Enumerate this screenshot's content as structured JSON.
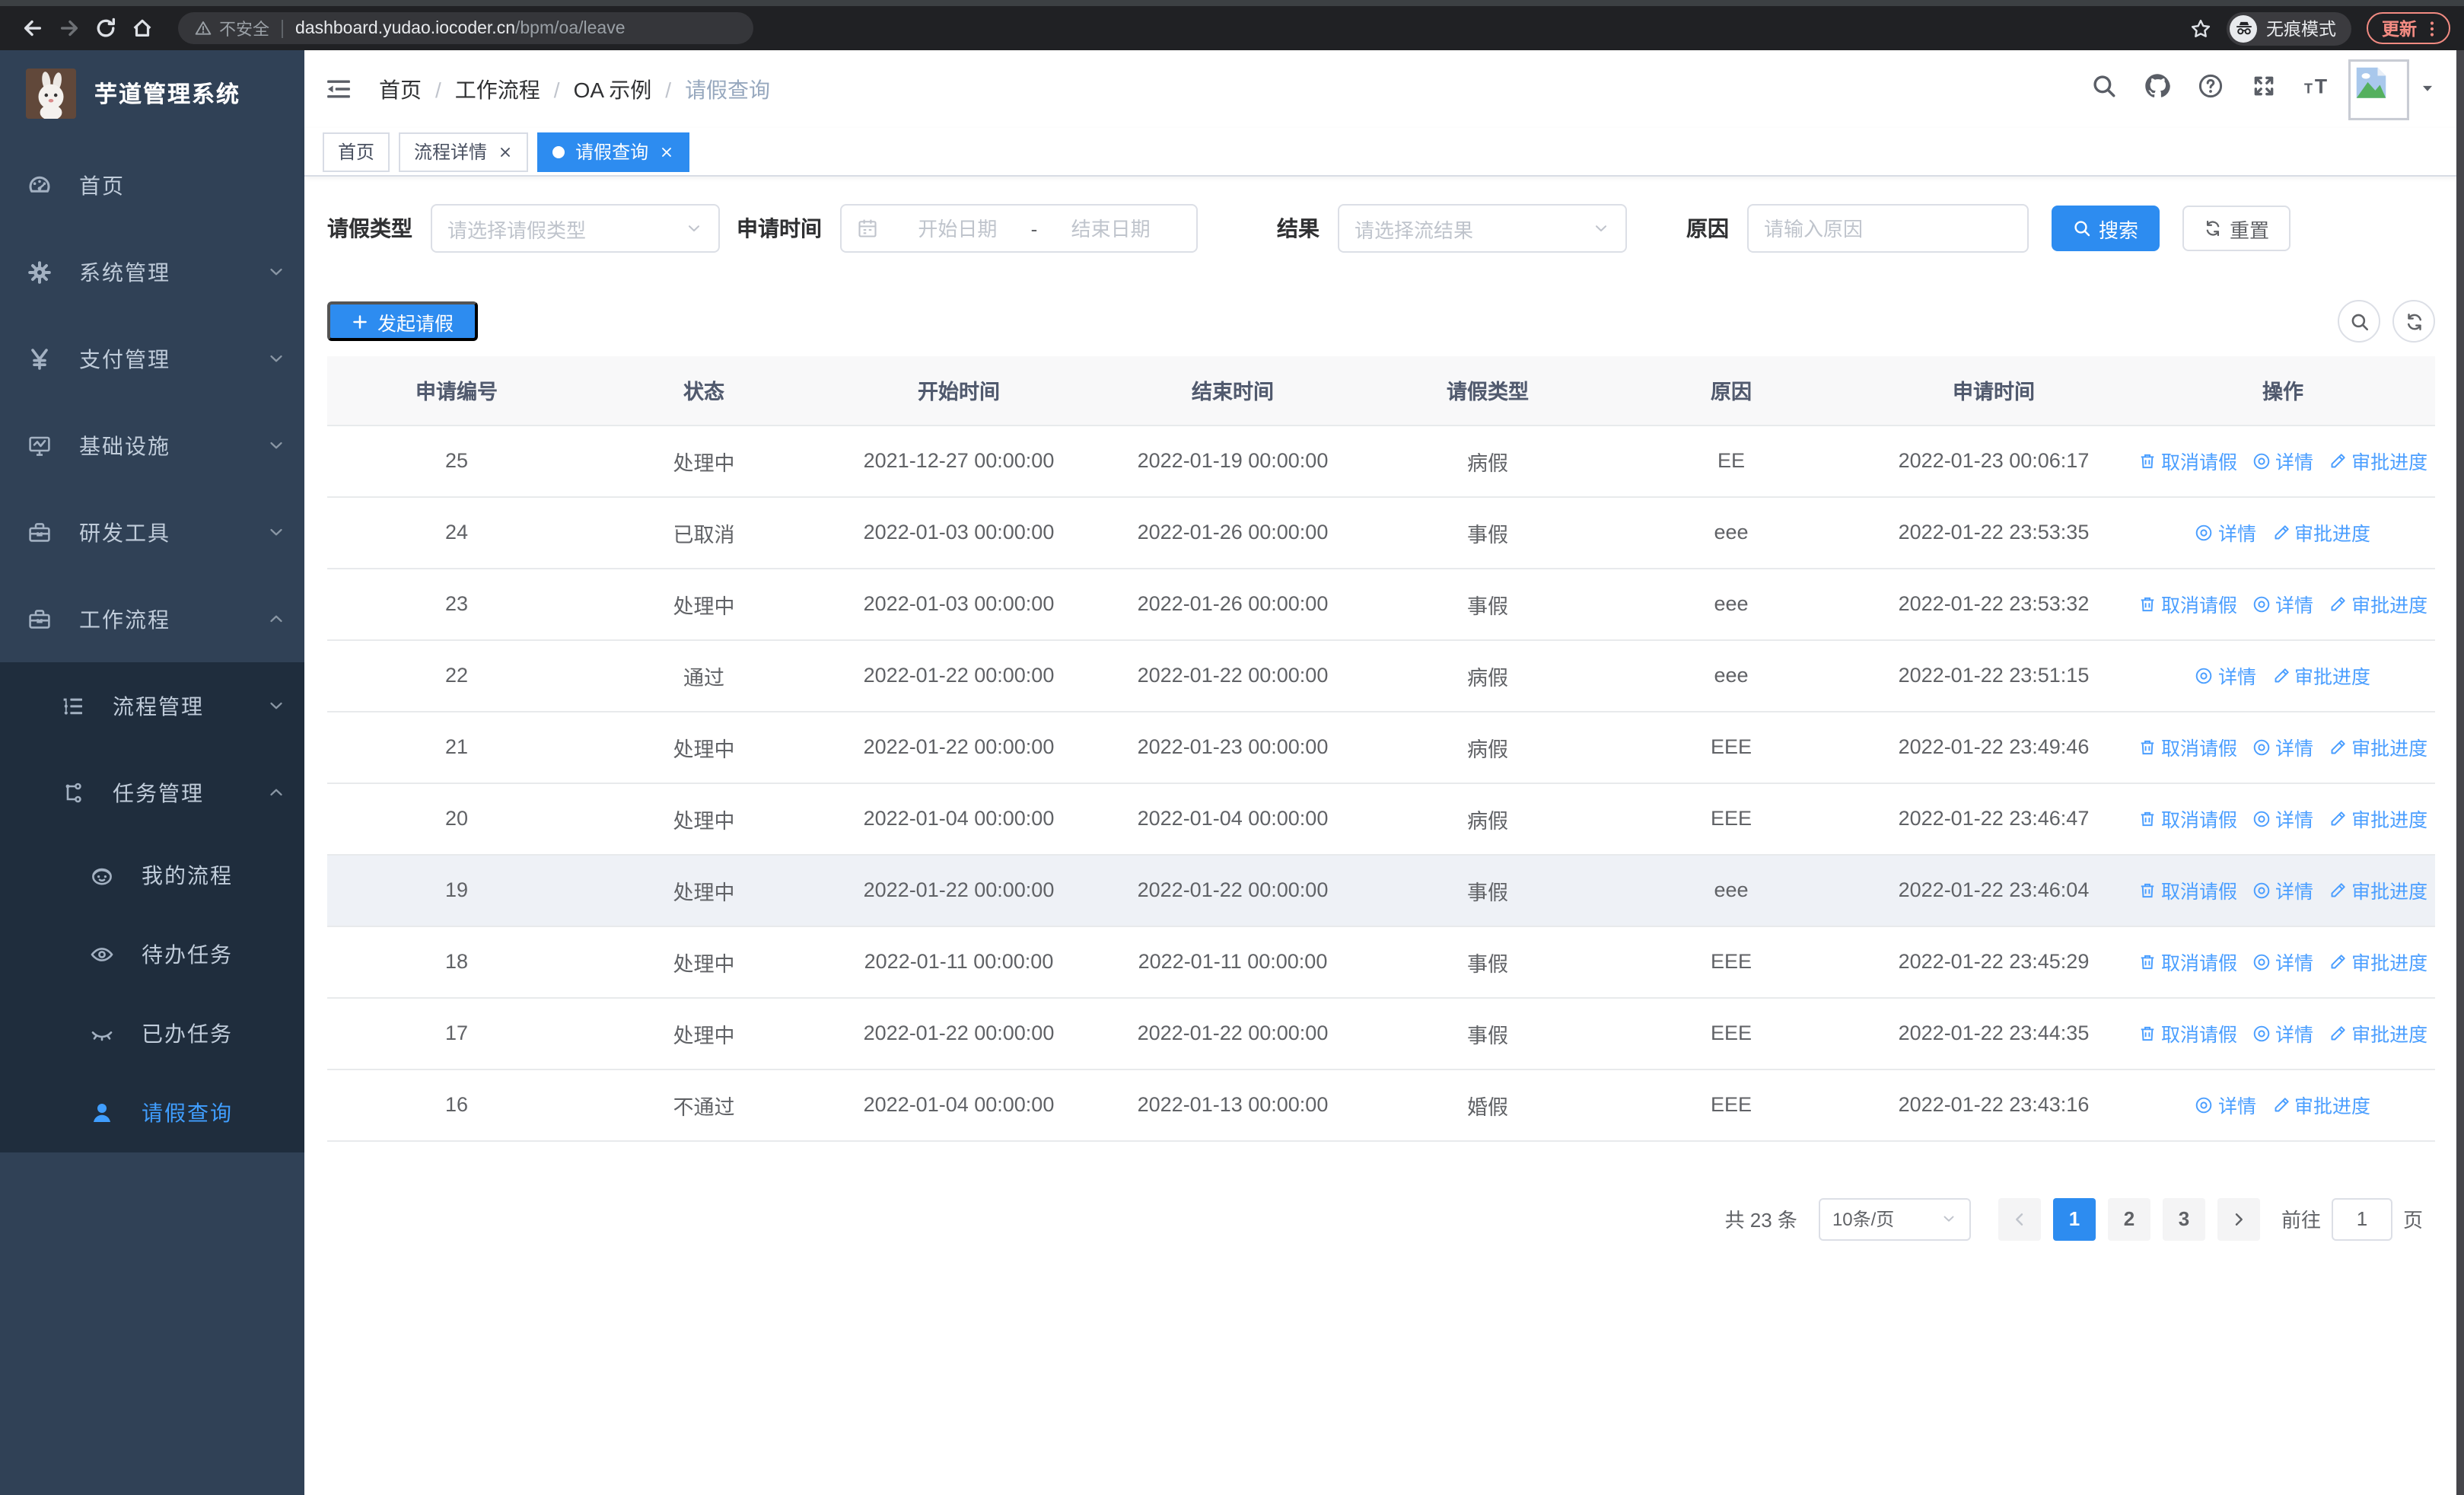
{
  "colors": {
    "primary_fill": "#2d8cf0",
    "primary_link": "#4a9eff",
    "sidebar_bg": "#304156",
    "submenu_bg": "#1f2d3d",
    "update_accent": "#f28b82"
  },
  "browser": {
    "security_label": "不安全",
    "url_host": "dashboard.yudao.iocoder.cn",
    "url_path": "/bpm/oa/leave",
    "incognito_label": "无痕模式",
    "update_label": "更新"
  },
  "sidebar": {
    "app_title": "芋道管理系统",
    "menu": [
      {
        "key": "home",
        "label": "首页",
        "icon": "dashboard-icon",
        "chevron": null,
        "level": 0,
        "dark": false,
        "active": false
      },
      {
        "key": "system",
        "label": "系统管理",
        "icon": "gear-icon",
        "chevron": "down",
        "level": 0,
        "dark": false,
        "active": false
      },
      {
        "key": "payment",
        "label": "支付管理",
        "icon": "yen-icon",
        "chevron": "down",
        "level": 0,
        "dark": false,
        "active": false
      },
      {
        "key": "infra",
        "label": "基础设施",
        "icon": "monitor-icon",
        "chevron": "down",
        "level": 0,
        "dark": false,
        "active": false
      },
      {
        "key": "dev-tools",
        "label": "研发工具",
        "icon": "toolbox-icon",
        "chevron": "down",
        "level": 0,
        "dark": false,
        "active": false
      },
      {
        "key": "workflow",
        "label": "工作流程",
        "icon": "toolbox-icon",
        "chevron": "up",
        "level": 0,
        "dark": false,
        "active": false
      },
      {
        "key": "process-mgmt",
        "label": "流程管理",
        "icon": "flowlist-icon",
        "chevron": "down",
        "level": 1,
        "dark": true,
        "active": false
      },
      {
        "key": "task-mgmt",
        "label": "任务管理",
        "icon": "tasktree-icon",
        "chevron": "up",
        "level": 1,
        "dark": true,
        "active": false
      },
      {
        "key": "my-process",
        "label": "我的流程",
        "icon": "face-icon",
        "chevron": null,
        "level": 2,
        "dark": true,
        "active": false
      },
      {
        "key": "todo-task",
        "label": "待办任务",
        "icon": "eye-open-icon",
        "chevron": null,
        "level": 2,
        "dark": true,
        "active": false
      },
      {
        "key": "done-task",
        "label": "已办任务",
        "icon": "eye-closed-icon",
        "chevron": null,
        "level": 2,
        "dark": true,
        "active": false
      },
      {
        "key": "leave-query",
        "label": "请假查询",
        "icon": "user-icon",
        "chevron": null,
        "level": 2,
        "dark": true,
        "active": true
      }
    ]
  },
  "navbar": {
    "breadcrumb": [
      "首页",
      "工作流程",
      "OA 示例",
      "请假查询"
    ],
    "breadcrumb_separator": "/",
    "right_icons": [
      "search-icon",
      "github-icon",
      "help-icon",
      "fullscreen-icon",
      "fontsize-icon"
    ]
  },
  "tabs": [
    {
      "key": "home",
      "label": "首页",
      "closable": false,
      "active": false
    },
    {
      "key": "process-detail",
      "label": "流程详情",
      "closable": true,
      "active": false
    },
    {
      "key": "leave-query",
      "label": "请假查询",
      "closable": true,
      "active": true
    }
  ],
  "filters": {
    "leave_type_label": "请假类型",
    "leave_type_placeholder": "请选择请假类型",
    "apply_time_label": "申请时间",
    "date_start_placeholder": "开始日期",
    "date_separator": "-",
    "date_end_placeholder": "结束日期",
    "result_label": "结果",
    "result_placeholder": "请选择流结果",
    "reason_label": "原因",
    "reason_placeholder": "请输入原因",
    "search_label": "搜索",
    "reset_label": "重置"
  },
  "toolbar": {
    "create_label": "发起请假"
  },
  "table": {
    "columns": [
      "申请编号",
      "状态",
      "开始时间",
      "结束时间",
      "请假类型",
      "原因",
      "申请时间",
      "操作"
    ],
    "action_labels": {
      "cancel": "取消请假",
      "detail": "详情",
      "progress": "审批进度"
    },
    "action_icons": {
      "cancel": "trash-icon",
      "detail": "eye-icon",
      "progress": "edit-icon"
    },
    "rows": [
      {
        "id": "25",
        "status": "处理中",
        "start": "2021-12-27 00:00:00",
        "end": "2022-01-19 00:00:00",
        "type": "病假",
        "reason": "EE",
        "apply": "2022-01-23 00:06:17",
        "actions": [
          "cancel",
          "detail",
          "progress"
        ],
        "highlight": false
      },
      {
        "id": "24",
        "status": "已取消",
        "start": "2022-01-03 00:00:00",
        "end": "2022-01-26 00:00:00",
        "type": "事假",
        "reason": "eee",
        "apply": "2022-01-22 23:53:35",
        "actions": [
          "detail",
          "progress"
        ],
        "highlight": false
      },
      {
        "id": "23",
        "status": "处理中",
        "start": "2022-01-03 00:00:00",
        "end": "2022-01-26 00:00:00",
        "type": "事假",
        "reason": "eee",
        "apply": "2022-01-22 23:53:32",
        "actions": [
          "cancel",
          "detail",
          "progress"
        ],
        "highlight": false
      },
      {
        "id": "22",
        "status": "通过",
        "start": "2022-01-22 00:00:00",
        "end": "2022-01-22 00:00:00",
        "type": "病假",
        "reason": "eee",
        "apply": "2022-01-22 23:51:15",
        "actions": [
          "detail",
          "progress"
        ],
        "highlight": false
      },
      {
        "id": "21",
        "status": "处理中",
        "start": "2022-01-22 00:00:00",
        "end": "2022-01-23 00:00:00",
        "type": "病假",
        "reason": "EEE",
        "apply": "2022-01-22 23:49:46",
        "actions": [
          "cancel",
          "detail",
          "progress"
        ],
        "highlight": false
      },
      {
        "id": "20",
        "status": "处理中",
        "start": "2022-01-04 00:00:00",
        "end": "2022-01-04 00:00:00",
        "type": "病假",
        "reason": "EEE",
        "apply": "2022-01-22 23:46:47",
        "actions": [
          "cancel",
          "detail",
          "progress"
        ],
        "highlight": false
      },
      {
        "id": "19",
        "status": "处理中",
        "start": "2022-01-22 00:00:00",
        "end": "2022-01-22 00:00:00",
        "type": "事假",
        "reason": "eee",
        "apply": "2022-01-22 23:46:04",
        "actions": [
          "cancel",
          "detail",
          "progress"
        ],
        "highlight": true
      },
      {
        "id": "18",
        "status": "处理中",
        "start": "2022-01-11 00:00:00",
        "end": "2022-01-11 00:00:00",
        "type": "事假",
        "reason": "EEE",
        "apply": "2022-01-22 23:45:29",
        "actions": [
          "cancel",
          "detail",
          "progress"
        ],
        "highlight": false
      },
      {
        "id": "17",
        "status": "处理中",
        "start": "2022-01-22 00:00:00",
        "end": "2022-01-22 00:00:00",
        "type": "事假",
        "reason": "EEE",
        "apply": "2022-01-22 23:44:35",
        "actions": [
          "cancel",
          "detail",
          "progress"
        ],
        "highlight": false
      },
      {
        "id": "16",
        "status": "不通过",
        "start": "2022-01-04 00:00:00",
        "end": "2022-01-13 00:00:00",
        "type": "婚假",
        "reason": "EEE",
        "apply": "2022-01-22 23:43:16",
        "actions": [
          "detail",
          "progress"
        ],
        "highlight": false
      }
    ]
  },
  "pagination": {
    "total_label": "共 23 条",
    "page_size": "10条/页",
    "pages": [
      "1",
      "2",
      "3"
    ],
    "active_page": "1",
    "goto_label": "前往",
    "goto_value": "1",
    "page_unit": "页"
  }
}
